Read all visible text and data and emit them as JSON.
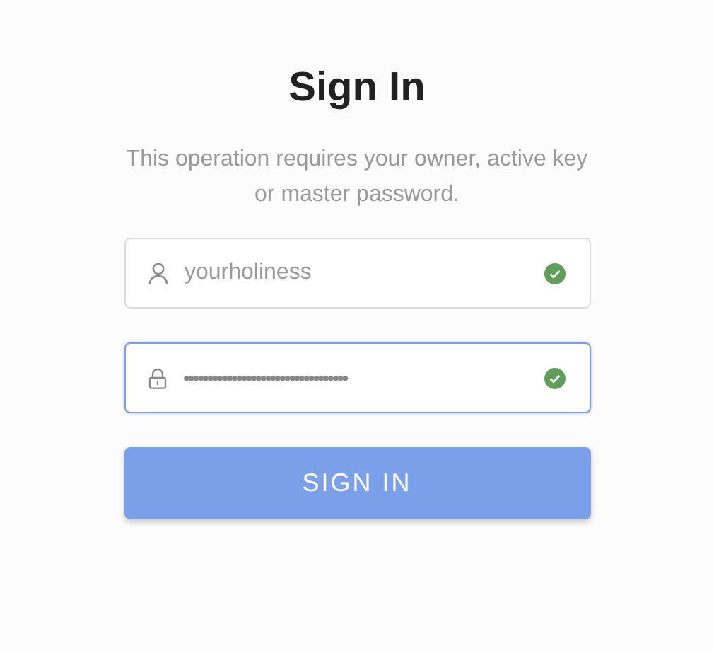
{
  "title": "Sign In",
  "description": "This operation requires your owner, active key or master password.",
  "fields": [
    {
      "kind": "username",
      "value": "yourholiness",
      "valid": true,
      "focused": false
    },
    {
      "kind": "password",
      "value": "••••••••••••••••••••••••••••••••••",
      "valid": true,
      "focused": true
    }
  ],
  "submit": "SIGN IN"
}
